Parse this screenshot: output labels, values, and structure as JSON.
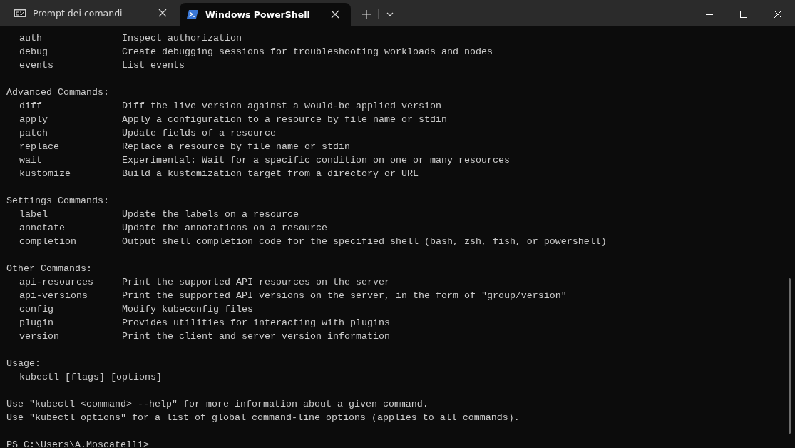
{
  "tabs": [
    {
      "title": "Prompt dei comandi",
      "kind": "cmd",
      "selected": false
    },
    {
      "title": "Windows PowerShell",
      "kind": "powershell",
      "selected": true
    }
  ],
  "terminal": {
    "blocks": [
      {
        "commands": [
          {
            "name": "auth",
            "description": "Inspect authorization"
          },
          {
            "name": "debug",
            "description": "Create debugging sessions for troubleshooting workloads and nodes"
          },
          {
            "name": "events",
            "description": "List events"
          }
        ]
      },
      {
        "heading": "Advanced Commands:",
        "commands": [
          {
            "name": "diff",
            "description": "Diff the live version against a would-be applied version"
          },
          {
            "name": "apply",
            "description": "Apply a configuration to a resource by file name or stdin"
          },
          {
            "name": "patch",
            "description": "Update fields of a resource"
          },
          {
            "name": "replace",
            "description": "Replace a resource by file name or stdin"
          },
          {
            "name": "wait",
            "description": "Experimental: Wait for a specific condition on one or many resources"
          },
          {
            "name": "kustomize",
            "description": "Build a kustomization target from a directory or URL"
          }
        ]
      },
      {
        "heading": "Settings Commands:",
        "commands": [
          {
            "name": "label",
            "description": "Update the labels on a resource"
          },
          {
            "name": "annotate",
            "description": "Update the annotations on a resource"
          },
          {
            "name": "completion",
            "description": "Output shell completion code for the specified shell (bash, zsh, fish, or powershell)"
          }
        ]
      },
      {
        "heading": "Other Commands:",
        "commands": [
          {
            "name": "api-resources",
            "description": "Print the supported API resources on the server"
          },
          {
            "name": "api-versions",
            "description": "Print the supported API versions on the server, in the form of \"group/version\""
          },
          {
            "name": "config",
            "description": "Modify kubeconfig files"
          },
          {
            "name": "plugin",
            "description": "Provides utilities for interacting with plugins"
          },
          {
            "name": "version",
            "description": "Print the client and server version information"
          }
        ]
      },
      {
        "heading": "Usage:",
        "lines": [
          "kubectl [flags] [options]"
        ]
      },
      {
        "lines": [
          "Use \"kubectl <command> --help\" for more information about a given command.",
          "Use \"kubectl options\" for a list of global command-line options (applies to all commands)."
        ]
      }
    ],
    "prompt": "PS C:\\Users\\A.Moscatelli>"
  }
}
